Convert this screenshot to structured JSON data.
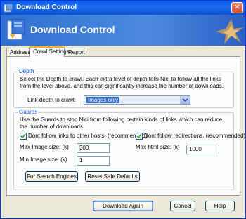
{
  "window": {
    "title": "Download Control"
  },
  "banner": {
    "title": "Download Control"
  },
  "tabs": [
    {
      "label": "Address"
    },
    {
      "label": "Crawl Settings"
    },
    {
      "label": "Report"
    }
  ],
  "depth": {
    "group_label": "Depth",
    "description": "Select the Depth to crawl. Each extra level of depth tells Nici to follow all the links from the level above, and this can significantly increase the number of downloads.",
    "link_depth_label": "Link depth to crawl:",
    "link_depth_value": "Images only"
  },
  "guards": {
    "group_label": "Guards",
    "description": "Use the Guards to stop Nici from following certain kinds of links which can reduce the number of downloads.",
    "dont_follow_hosts_label": "Dont follow links to other hosts. (recommended)",
    "dont_follow_redirects_label": "Dont follow redirections. (recommended)",
    "max_image_size_label": "Max Image size: (k)",
    "max_image_size_value": "300",
    "max_html_size_label": "Max html size: (k)",
    "max_html_size_value": "1000",
    "min_image_size_label": "Min Image size: (k)",
    "min_image_size_value": "1",
    "search_engines_btn": "For Search Engines",
    "reset_defaults_btn": "Reset Safe Defaults"
  },
  "footer": {
    "download_again": "Download Again",
    "cancel": "Cancel",
    "help": "Help"
  }
}
